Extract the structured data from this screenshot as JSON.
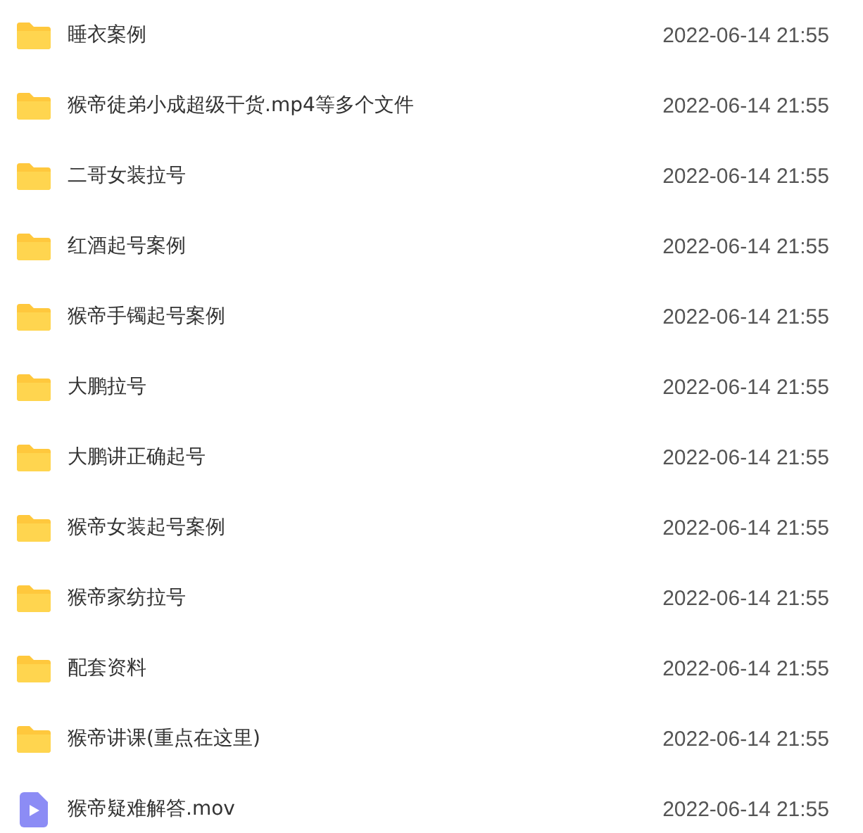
{
  "files": [
    {
      "kind": "folder",
      "name": "睡衣案例",
      "modified": "2022-06-14 21:55"
    },
    {
      "kind": "folder",
      "name": "猴帝徒弟小成超级干货.mp4等多个文件",
      "modified": "2022-06-14 21:55"
    },
    {
      "kind": "folder",
      "name": "二哥女装拉号",
      "modified": "2022-06-14 21:55"
    },
    {
      "kind": "folder",
      "name": "红酒起号案例",
      "modified": "2022-06-14 21:55"
    },
    {
      "kind": "folder",
      "name": "猴帝手镯起号案例",
      "modified": "2022-06-14 21:55"
    },
    {
      "kind": "folder",
      "name": "大鹏拉号",
      "modified": "2022-06-14 21:55"
    },
    {
      "kind": "folder",
      "name": "大鹏讲正确起号",
      "modified": "2022-06-14 21:55"
    },
    {
      "kind": "folder",
      "name": "猴帝女装起号案例",
      "modified": "2022-06-14 21:55"
    },
    {
      "kind": "folder",
      "name": "猴帝家纺拉号",
      "modified": "2022-06-14 21:55"
    },
    {
      "kind": "folder",
      "name": "配套资料",
      "modified": "2022-06-14 21:55"
    },
    {
      "kind": "folder",
      "name": "猴帝讲课(重点在这里)",
      "modified": "2022-06-14 21:55"
    },
    {
      "kind": "video",
      "name": "猴帝疑难解答.mov",
      "modified": "2022-06-14 21:55"
    }
  ]
}
